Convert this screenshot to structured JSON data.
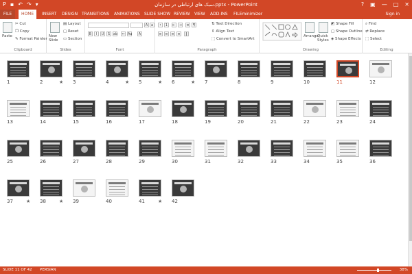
{
  "window": {
    "title": "سبک های ارتباطی در سازمان.pptx - PowerPoint",
    "controls": [
      "?",
      "▣",
      "—",
      "□",
      "✕"
    ]
  },
  "tabs": [
    {
      "label": "FILE"
    },
    {
      "label": "HOME"
    },
    {
      "label": "INSERT"
    },
    {
      "label": "DESIGN"
    },
    {
      "label": "TRANSITIONS"
    },
    {
      "label": "ANIMATIONS"
    },
    {
      "label": "SLIDE SHOW"
    },
    {
      "label": "REVIEW"
    },
    {
      "label": "VIEW"
    },
    {
      "label": "ADD-INS"
    },
    {
      "label": "FILEminimizer"
    }
  ],
  "sign_in": "Sign in",
  "ribbon": {
    "clipboard": {
      "label": "Clipboard",
      "paste": "Paste",
      "cut": "Cut",
      "copy": "Copy",
      "format_painter": "Format Painter"
    },
    "slides": {
      "label": "Slides",
      "new_slide": "New Slide",
      "layout": "Layout",
      "reset": "Reset",
      "section": "Section"
    },
    "font": {
      "label": "Font"
    },
    "paragraph": {
      "label": "Paragraph",
      "text_direction": "Text Direction",
      "align_text": "Align Text",
      "convert_smartart": "Convert to SmartArt"
    },
    "drawing": {
      "label": "Drawing",
      "arrange": "Arrange",
      "quick_styles": "Quick Styles",
      "shape_fill": "Shape Fill",
      "shape_outline": "Shape Outline",
      "shape_effects": "Shape Effects"
    },
    "editing": {
      "label": "Editing",
      "find": "Find",
      "replace": "Replace",
      "select": "Select"
    }
  },
  "slides": [
    {
      "n": "1",
      "star": false,
      "dark": true
    },
    {
      "n": "2",
      "star": true,
      "dark": true
    },
    {
      "n": "3",
      "star": false,
      "dark": true
    },
    {
      "n": "4",
      "star": true,
      "dark": true
    },
    {
      "n": "5",
      "star": true,
      "dark": true
    },
    {
      "n": "6",
      "star": true,
      "dark": true
    },
    {
      "n": "7",
      "star": false,
      "dark": true
    },
    {
      "n": "8",
      "star": false,
      "dark": true
    },
    {
      "n": "9",
      "star": false,
      "dark": true
    },
    {
      "n": "10",
      "star": false,
      "dark": true
    },
    {
      "n": "11",
      "star": false,
      "dark": true,
      "selected": true
    },
    {
      "n": "12",
      "star": false,
      "dark": false
    },
    {
      "n": "13",
      "star": false,
      "dark": false
    },
    {
      "n": "14",
      "star": false,
      "dark": true
    },
    {
      "n": "15",
      "star": false,
      "dark": true
    },
    {
      "n": "16",
      "star": false,
      "dark": true
    },
    {
      "n": "17",
      "star": false,
      "dark": false
    },
    {
      "n": "18",
      "star": false,
      "dark": true
    },
    {
      "n": "19",
      "star": false,
      "dark": true
    },
    {
      "n": "20",
      "star": false,
      "dark": true
    },
    {
      "n": "21",
      "star": false,
      "dark": true
    },
    {
      "n": "22",
      "star": false,
      "dark": false
    },
    {
      "n": "23",
      "star": false,
      "dark": false
    },
    {
      "n": "24",
      "star": false,
      "dark": true
    },
    {
      "n": "25",
      "star": false,
      "dark": true
    },
    {
      "n": "26",
      "star": false,
      "dark": true
    },
    {
      "n": "27",
      "star": false,
      "dark": true
    },
    {
      "n": "28",
      "star": false,
      "dark": true
    },
    {
      "n": "29",
      "star": false,
      "dark": true
    },
    {
      "n": "30",
      "star": false,
      "dark": false
    },
    {
      "n": "31",
      "star": false,
      "dark": false
    },
    {
      "n": "32",
      "star": false,
      "dark": true
    },
    {
      "n": "33",
      "star": false,
      "dark": true
    },
    {
      "n": "34",
      "star": false,
      "dark": false
    },
    {
      "n": "35",
      "star": false,
      "dark": false
    },
    {
      "n": "36",
      "star": false,
      "dark": true
    },
    {
      "n": "37",
      "star": true,
      "dark": true
    },
    {
      "n": "38",
      "star": true,
      "dark": true
    },
    {
      "n": "39",
      "star": false,
      "dark": false
    },
    {
      "n": "40",
      "star": false,
      "dark": false
    },
    {
      "n": "41",
      "star": true,
      "dark": true
    },
    {
      "n": "42",
      "star": false,
      "dark": true
    }
  ],
  "status": {
    "slide_indicator": "SLIDE 11 OF 42",
    "language": "PERSIAN",
    "zoom": "38%"
  },
  "colors": {
    "accent": "#d24726"
  }
}
